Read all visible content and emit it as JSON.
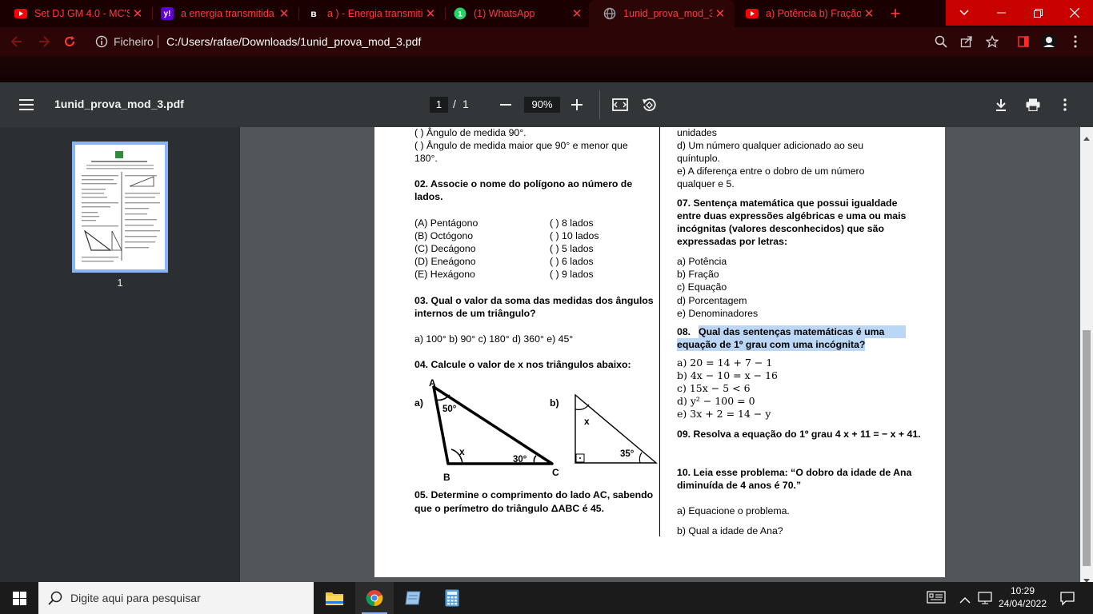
{
  "browser": {
    "tabs": [
      {
        "label": "Set DJ GM 4.0 - MC'S",
        "favicon": "youtube-icon"
      },
      {
        "label": "a energia transmitida",
        "favicon": "yahoo-icon"
      },
      {
        "label": "a ) - Energia transmiti",
        "favicon": "brainly-icon"
      },
      {
        "label": "(1) WhatsApp",
        "favicon": "whatsapp-icon"
      },
      {
        "label": "1unid_prova_mod_3.p",
        "favicon": "globe-icon"
      },
      {
        "label": "a) Potência b) Fração",
        "favicon": "youtube-icon"
      }
    ],
    "url_prefix": "Ficheiro",
    "url": "C:/Users/rafae/Downloads/1unid_prova_mod_3.pdf"
  },
  "viewer": {
    "title": "1unid_prova_mod_3.pdf",
    "page_current": "1",
    "page_sep": "/",
    "page_total": "1",
    "zoom": "90%",
    "thumb_label": "1"
  },
  "doc": {
    "q01_a": "(   ) Ângulo de medida 90°.",
    "q01_b1": "(   ) Ângulo de medida maior que 90° e menor que",
    "q01_b2": "180°.",
    "q02_1": "02. Associe o nome do polígono ao número de",
    "q02_2": "lados.",
    "q02_left": [
      "(A) Pentágono",
      "(B) Octógono",
      "(C) Decágono",
      "(D) Eneágono",
      "(E) Hexágono"
    ],
    "q02_right": [
      "(    ) 8 lados",
      "(    ) 10 lados",
      "(    ) 5 lados",
      "(    ) 6 lados",
      "(    ) 9 lados"
    ],
    "q03_1": "03. Qual o valor da soma das medidas dos ângulos",
    "q03_2": "internos de um triângulo?",
    "q03_opts": "a) 100° b) 90° c) 180° d) 360° e) 45°",
    "q04": "04. Calcule o valor de x nos triângulos abaixo:",
    "tri_a": {
      "label": "a)",
      "A": "A",
      "B": "B",
      "C": "C",
      "ang_a": "50°",
      "ang_x": "x",
      "ang_c": "30°"
    },
    "tri_b": {
      "label": "b)",
      "ang_x": "x",
      "ang_35": "35°"
    },
    "q05_1": "05. Determine o comprimento do lado AC, sabendo",
    "q05_2": "que o perímetro do triângulo ΔABC é 45.",
    "q06_c": "unidades",
    "q06_d1": "d)  Um  número  qualquer  adicionado  ao  seu",
    "q06_d2": "quíntuplo.",
    "q06_e1": "e) A diferença entre o dobro de um número",
    "q06_e2": "qualquer e 5.",
    "q07_1": "07. Sentença matemática que possui igualdade",
    "q07_2": "entre duas expressões algébricas e uma ou mais",
    "q07_3": "incógnitas  (valores  desconhecidos)  que  são",
    "q07_4": "expressadas por letras:",
    "q07_opts": [
      "a) Potência",
      "b) Fração",
      "c) Equação",
      "d) Porcentagem",
      "e) Denominadores"
    ],
    "q08_num": "08.",
    "q08_1": "Qual das sentenças matemáticas é uma",
    "q08_2": "equação de 1º grau com uma incógnita?",
    "q08_opts": [
      "a) 20 = 14 + 7 − 1",
      "b) 4x − 10 = x − 16",
      "c) 15x − 5 < 6",
      "d) y² − 100 = 0",
      "e) 3x + 2 = 14 − y"
    ],
    "q09": "09. Resolva a equação do 1º grau 4 x + 11 = − x + 41.",
    "q10_1": "10. Leia esse problema: “O dobro da idade de Ana",
    "q10_2": "diminuída de 4 anos é 70.”",
    "q10_a": "a) Equacione o problema.",
    "q10_b": "b) Qual a idade de Ana?"
  },
  "taskbar": {
    "search_placeholder": "Digite aqui para pesquisar",
    "time": "10:29",
    "date": "24/04/2022"
  }
}
